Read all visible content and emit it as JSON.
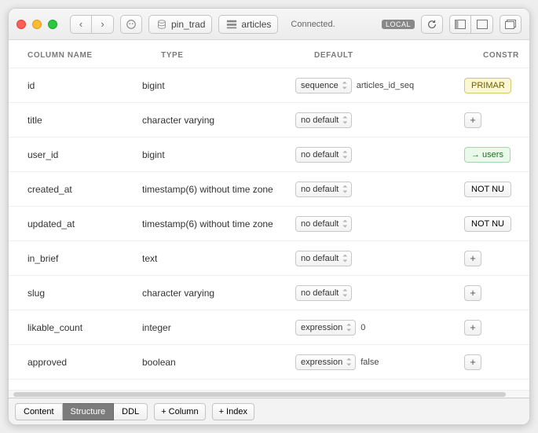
{
  "toolbar": {
    "db_label": "pin_trad",
    "table_label": "articles",
    "status": "Connected.",
    "env_badge": "LOCAL"
  },
  "headers": {
    "name": "COLUMN NAME",
    "type": "TYPE",
    "default": "DEFAULT",
    "constraints": "CONSTR"
  },
  "columns": [
    {
      "name": "id",
      "type": "bigint",
      "default_mode": "sequence",
      "default_value": "articles_id_seq",
      "constraint": {
        "label": "PRIMAR",
        "kind": "primary"
      }
    },
    {
      "name": "title",
      "type": "character varying",
      "default_mode": "no default",
      "default_value": "",
      "constraint": {
        "label": "",
        "kind": "plus"
      }
    },
    {
      "name": "user_id",
      "type": "bigint",
      "default_mode": "no default",
      "default_value": "",
      "constraint": {
        "label": "→ users",
        "kind": "fk"
      }
    },
    {
      "name": "created_at",
      "type": "timestamp(6) without time zone",
      "default_mode": "no default",
      "default_value": "",
      "constraint": {
        "label": "NOT NU",
        "kind": "notnull"
      }
    },
    {
      "name": "updated_at",
      "type": "timestamp(6) without time zone",
      "default_mode": "no default",
      "default_value": "",
      "constraint": {
        "label": "NOT NU",
        "kind": "notnull"
      }
    },
    {
      "name": "in_brief",
      "type": "text",
      "default_mode": "no default",
      "default_value": "",
      "constraint": {
        "label": "",
        "kind": "plus"
      }
    },
    {
      "name": "slug",
      "type": "character varying",
      "default_mode": "no default",
      "default_value": "",
      "constraint": {
        "label": "",
        "kind": "plus"
      }
    },
    {
      "name": "likable_count",
      "type": "integer",
      "default_mode": "expression",
      "default_value": "0",
      "constraint": {
        "label": "",
        "kind": "plus"
      }
    },
    {
      "name": "approved",
      "type": "boolean",
      "default_mode": "expression",
      "default_value": "false",
      "constraint": {
        "label": "",
        "kind": "plus"
      }
    }
  ],
  "footer": {
    "tabs": [
      "Content",
      "Structure",
      "DDL"
    ],
    "active_tab": 1,
    "add_column": "+ Column",
    "add_index": "+ Index"
  }
}
